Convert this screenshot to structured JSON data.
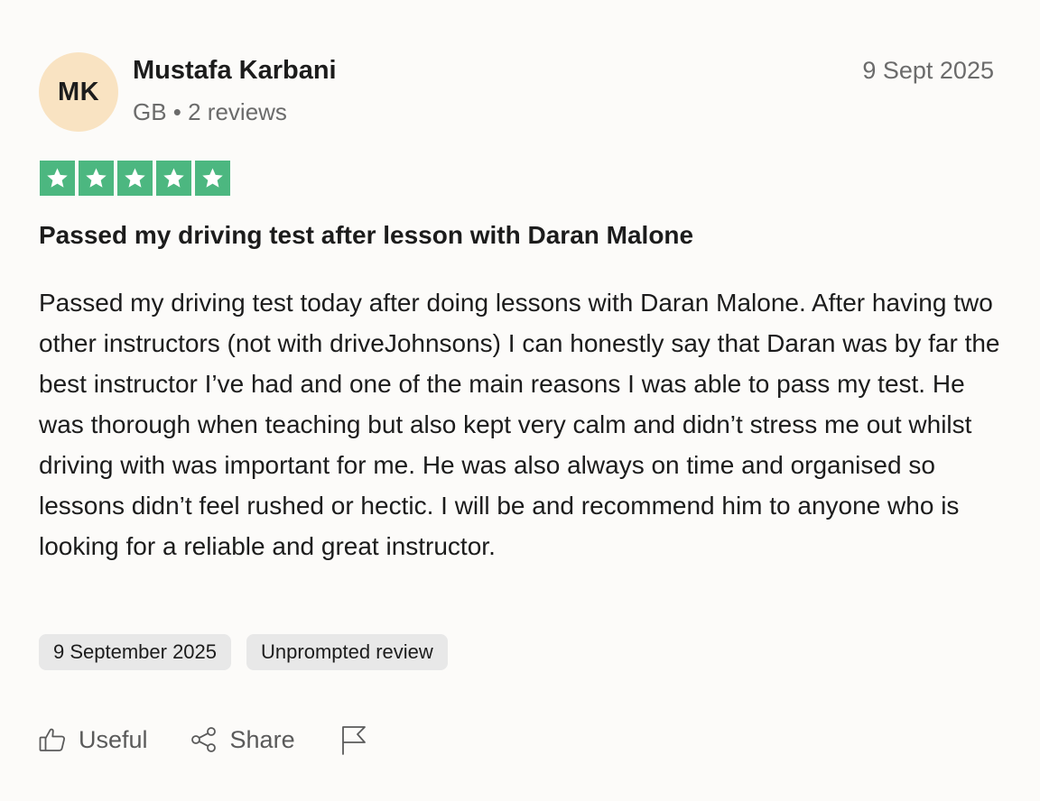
{
  "reviewer": {
    "initials": "MK",
    "name": "Mustafa Karbani",
    "meta": "GB • 2 reviews",
    "avatar_color": "#f9e3c2"
  },
  "review": {
    "date": "9 Sept 2025",
    "rating": 5,
    "star_color": "#4cb780",
    "title": "Passed my driving test after lesson with Daran Malone",
    "body": "Passed my driving test today after doing lessons with Daran Malone. After having two other instructors (not with driveJohnsons) I can honestly say that Daran was by far the best instructor I’ve had and one of the main reasons I was able to pass my test. He was thorough when teaching but also kept very calm and didn’t stress me out whilst driving with was important for me. He was also always on time and organised so lessons didn’t feel rushed or hectic. I will be and recommend him to anyone who is looking for a reliable and great instructor.",
    "tags": [
      "9 September 2025",
      "Unprompted review"
    ]
  },
  "actions": {
    "useful_label": "Useful",
    "useful_icon": "thumbs-up-icon",
    "share_label": "Share",
    "share_icon": "share-icon",
    "report_icon": "flag-icon"
  }
}
